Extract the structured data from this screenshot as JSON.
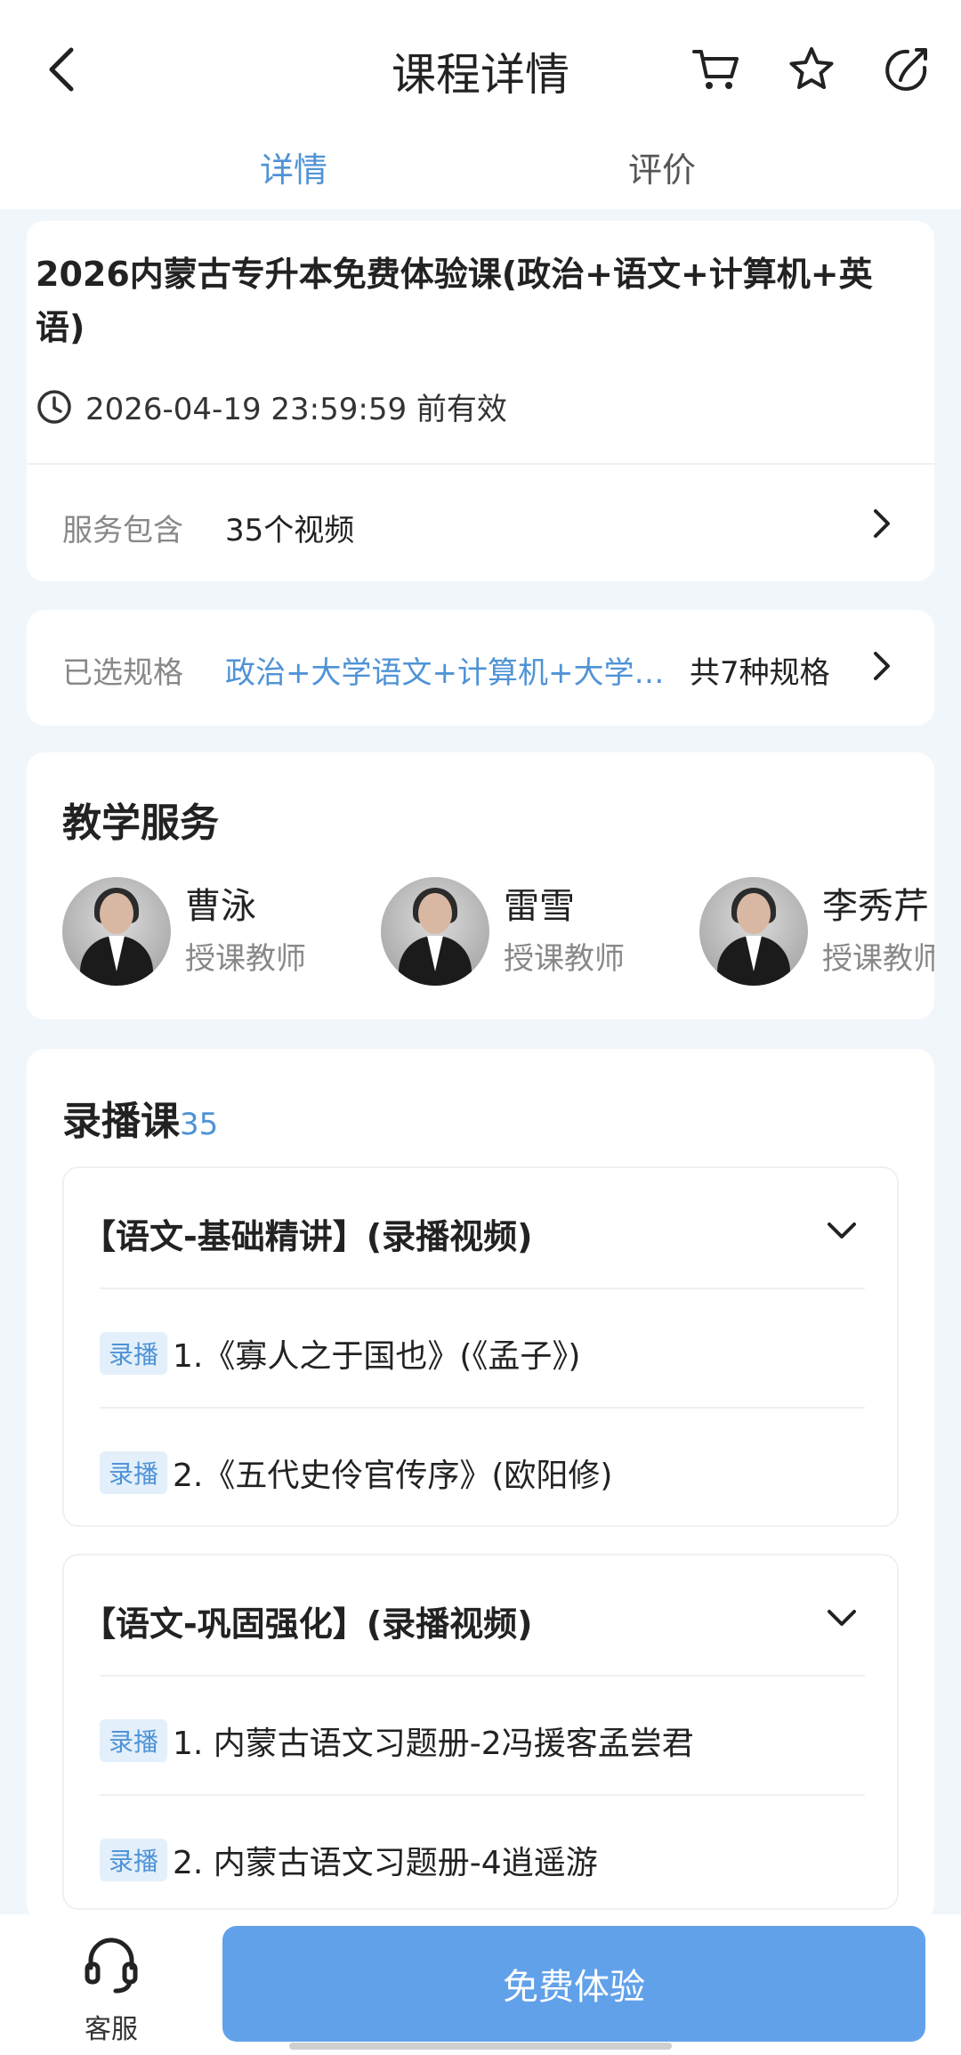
{
  "header": {
    "title": "课程详情",
    "tabs": [
      {
        "label": "详情",
        "active": true
      },
      {
        "label": "评价",
        "active": false
      }
    ]
  },
  "course": {
    "title": "2026内蒙古专升本免费体验课(政治+语文+计算机+英语)",
    "valid_until": "2026-04-19 23:59:59 前有效",
    "service_label": "服务包含",
    "service_value": "35个视频"
  },
  "spec": {
    "label": "已选规格",
    "value": "政治+大学语文+计算机+大学…",
    "count": "共7种规格"
  },
  "teaching": {
    "title": "教学服务",
    "teachers": [
      {
        "name": "曹泳",
        "role": "授课教师"
      },
      {
        "name": "雷雪",
        "role": "授课教师"
      },
      {
        "name": "李秀芹",
        "role": "授课教师"
      }
    ]
  },
  "recorded": {
    "title": "录播课",
    "count": "35",
    "groups": [
      {
        "title": "【语文-基础精讲】(录播视频)",
        "lessons": [
          {
            "badge": "录播",
            "title": "1.《寡人之于国也》(《孟子》)"
          },
          {
            "badge": "录播",
            "title": "2.《五代史伶官传序》(欧阳修)"
          }
        ]
      },
      {
        "title": "【语文-巩固强化】(录播视频)",
        "lessons": [
          {
            "badge": "录播",
            "title": "1. 内蒙古语文习题册-2冯援客孟尝君"
          },
          {
            "badge": "录播",
            "title": "2. 内蒙古语文习题册-4逍遥游"
          }
        ]
      }
    ]
  },
  "bottom": {
    "service_label": "客服",
    "primary_button": "免费体验"
  },
  "colors": {
    "accent": "#4f93d6",
    "button": "#61a1ea",
    "background": "#f1f6fb"
  }
}
